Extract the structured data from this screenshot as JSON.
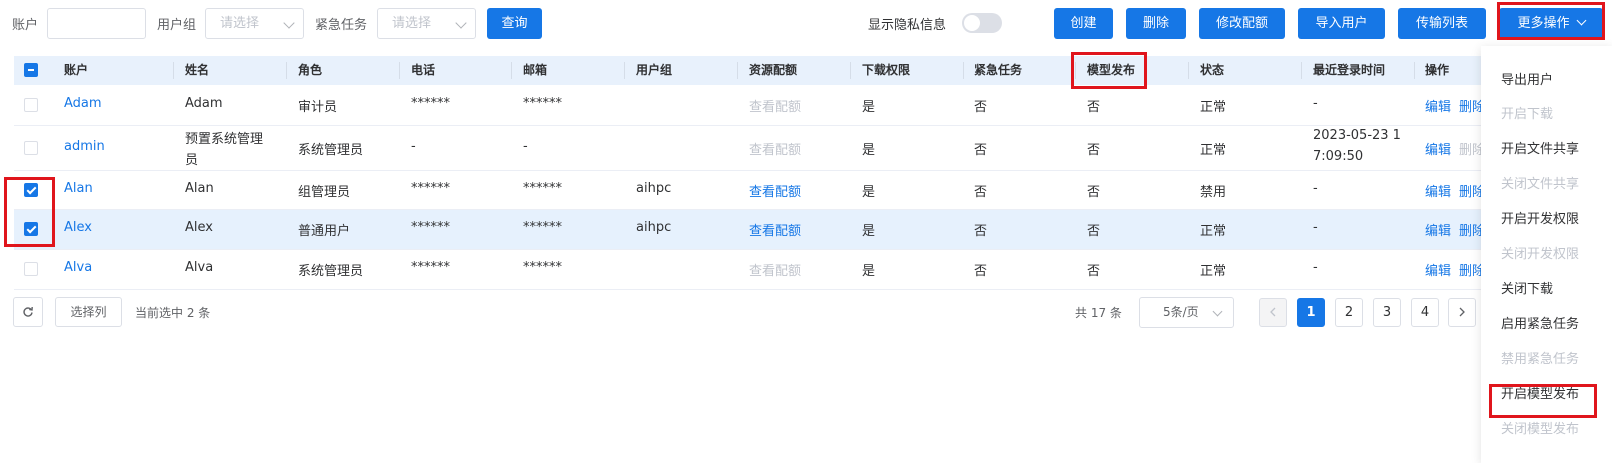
{
  "filters": {
    "account_label": "账户",
    "group_label": "用户组",
    "group_placeholder": "请选择",
    "urgent_label": "紧急任务",
    "urgent_placeholder": "请选择",
    "query_button": "查询"
  },
  "privacy": {
    "label": "显示隐私信息",
    "on": false
  },
  "actions": {
    "create": "创建",
    "delete": "删除",
    "edit_quota": "修改配额",
    "import_users": "导入用户",
    "transfer_list": "传输列表",
    "more": "更多操作"
  },
  "table": {
    "columns": [
      "账户",
      "姓名",
      "角色",
      "电话",
      "邮箱",
      "用户组",
      "资源配额",
      "下载权限",
      "紧急任务",
      "模型发布",
      "状态",
      "最近登录时间",
      "操作"
    ],
    "rows": [
      {
        "checked": false,
        "account": "Adam",
        "name": "Adam",
        "name2": "",
        "role": "审计员",
        "phone": "******",
        "email": "******",
        "group": "",
        "quota": "查看配额",
        "quota_active": false,
        "download": "是",
        "urgent": "否",
        "model_publish": "否",
        "status": "正常",
        "last_login": "-",
        "last_login2": "",
        "op_edit": "编辑",
        "op_delete": "删除",
        "op_delete_active": true
      },
      {
        "checked": false,
        "account": "admin",
        "name": "预置系统管理",
        "name2": "员",
        "role": "系统管理员",
        "phone": "-",
        "email": "-",
        "group": "",
        "quota": "查看配额",
        "quota_active": false,
        "download": "是",
        "urgent": "否",
        "model_publish": "否",
        "status": "正常",
        "last_login": "2023-05-23 1",
        "last_login2": "7:09:50",
        "op_edit": "编辑",
        "op_delete": "删除",
        "op_delete_active": false
      },
      {
        "checked": true,
        "account": "Alan",
        "name": "Alan",
        "name2": "",
        "role": "组管理员",
        "phone": "******",
        "email": "******",
        "group": "aihpc",
        "quota": "查看配额",
        "quota_active": true,
        "download": "是",
        "urgent": "否",
        "model_publish": "否",
        "status": "禁用",
        "last_login": "-",
        "last_login2": "",
        "op_edit": "编辑",
        "op_delete": "删除",
        "op_delete_active": true
      },
      {
        "checked": true,
        "account": "Alex",
        "name": "Alex",
        "name2": "",
        "role": "普通用户",
        "phone": "******",
        "email": "******",
        "group": "aihpc",
        "quota": "查看配额",
        "quota_active": true,
        "download": "是",
        "urgent": "否",
        "model_publish": "否",
        "status": "正常",
        "last_login": "-",
        "last_login2": "",
        "op_edit": "编辑",
        "op_delete": "删除",
        "op_delete_active": true
      },
      {
        "checked": false,
        "account": "Alva",
        "name": "Alva",
        "name2": "",
        "role": "系统管理员",
        "phone": "******",
        "email": "******",
        "group": "",
        "quota": "查看配额",
        "quota_active": false,
        "download": "是",
        "urgent": "否",
        "model_publish": "否",
        "status": "正常",
        "last_login": "-",
        "last_login2": "",
        "op_edit": "编辑",
        "op_delete": "删除",
        "op_delete_active": true
      }
    ]
  },
  "footer": {
    "select_columns": "选择列",
    "selected_text": "当前选中 2 条",
    "total_text": "共 17 条",
    "page_size": "5条/页",
    "pages": [
      "1",
      "2",
      "3",
      "4"
    ],
    "current_page": "1"
  },
  "more_menu": [
    {
      "label": "导出用户",
      "disabled": false
    },
    {
      "label": "开启下载",
      "disabled": true
    },
    {
      "label": "开启文件共享",
      "disabled": false
    },
    {
      "label": "关闭文件共享",
      "disabled": true
    },
    {
      "label": "开启开发权限",
      "disabled": false
    },
    {
      "label": "关闭开发权限",
      "disabled": true
    },
    {
      "label": "关闭下载",
      "disabled": false
    },
    {
      "label": "启用紧急任务",
      "disabled": false
    },
    {
      "label": "禁用紧急任务",
      "disabled": true
    },
    {
      "label": "开启模型发布",
      "disabled": false
    },
    {
      "label": "关闭模型发布",
      "disabled": true
    }
  ],
  "colors": {
    "primary": "#1677e6",
    "highlight": "#e0151c",
    "header_bg": "#e8f1fc",
    "selected_row_bg": "#e6f1fd"
  }
}
